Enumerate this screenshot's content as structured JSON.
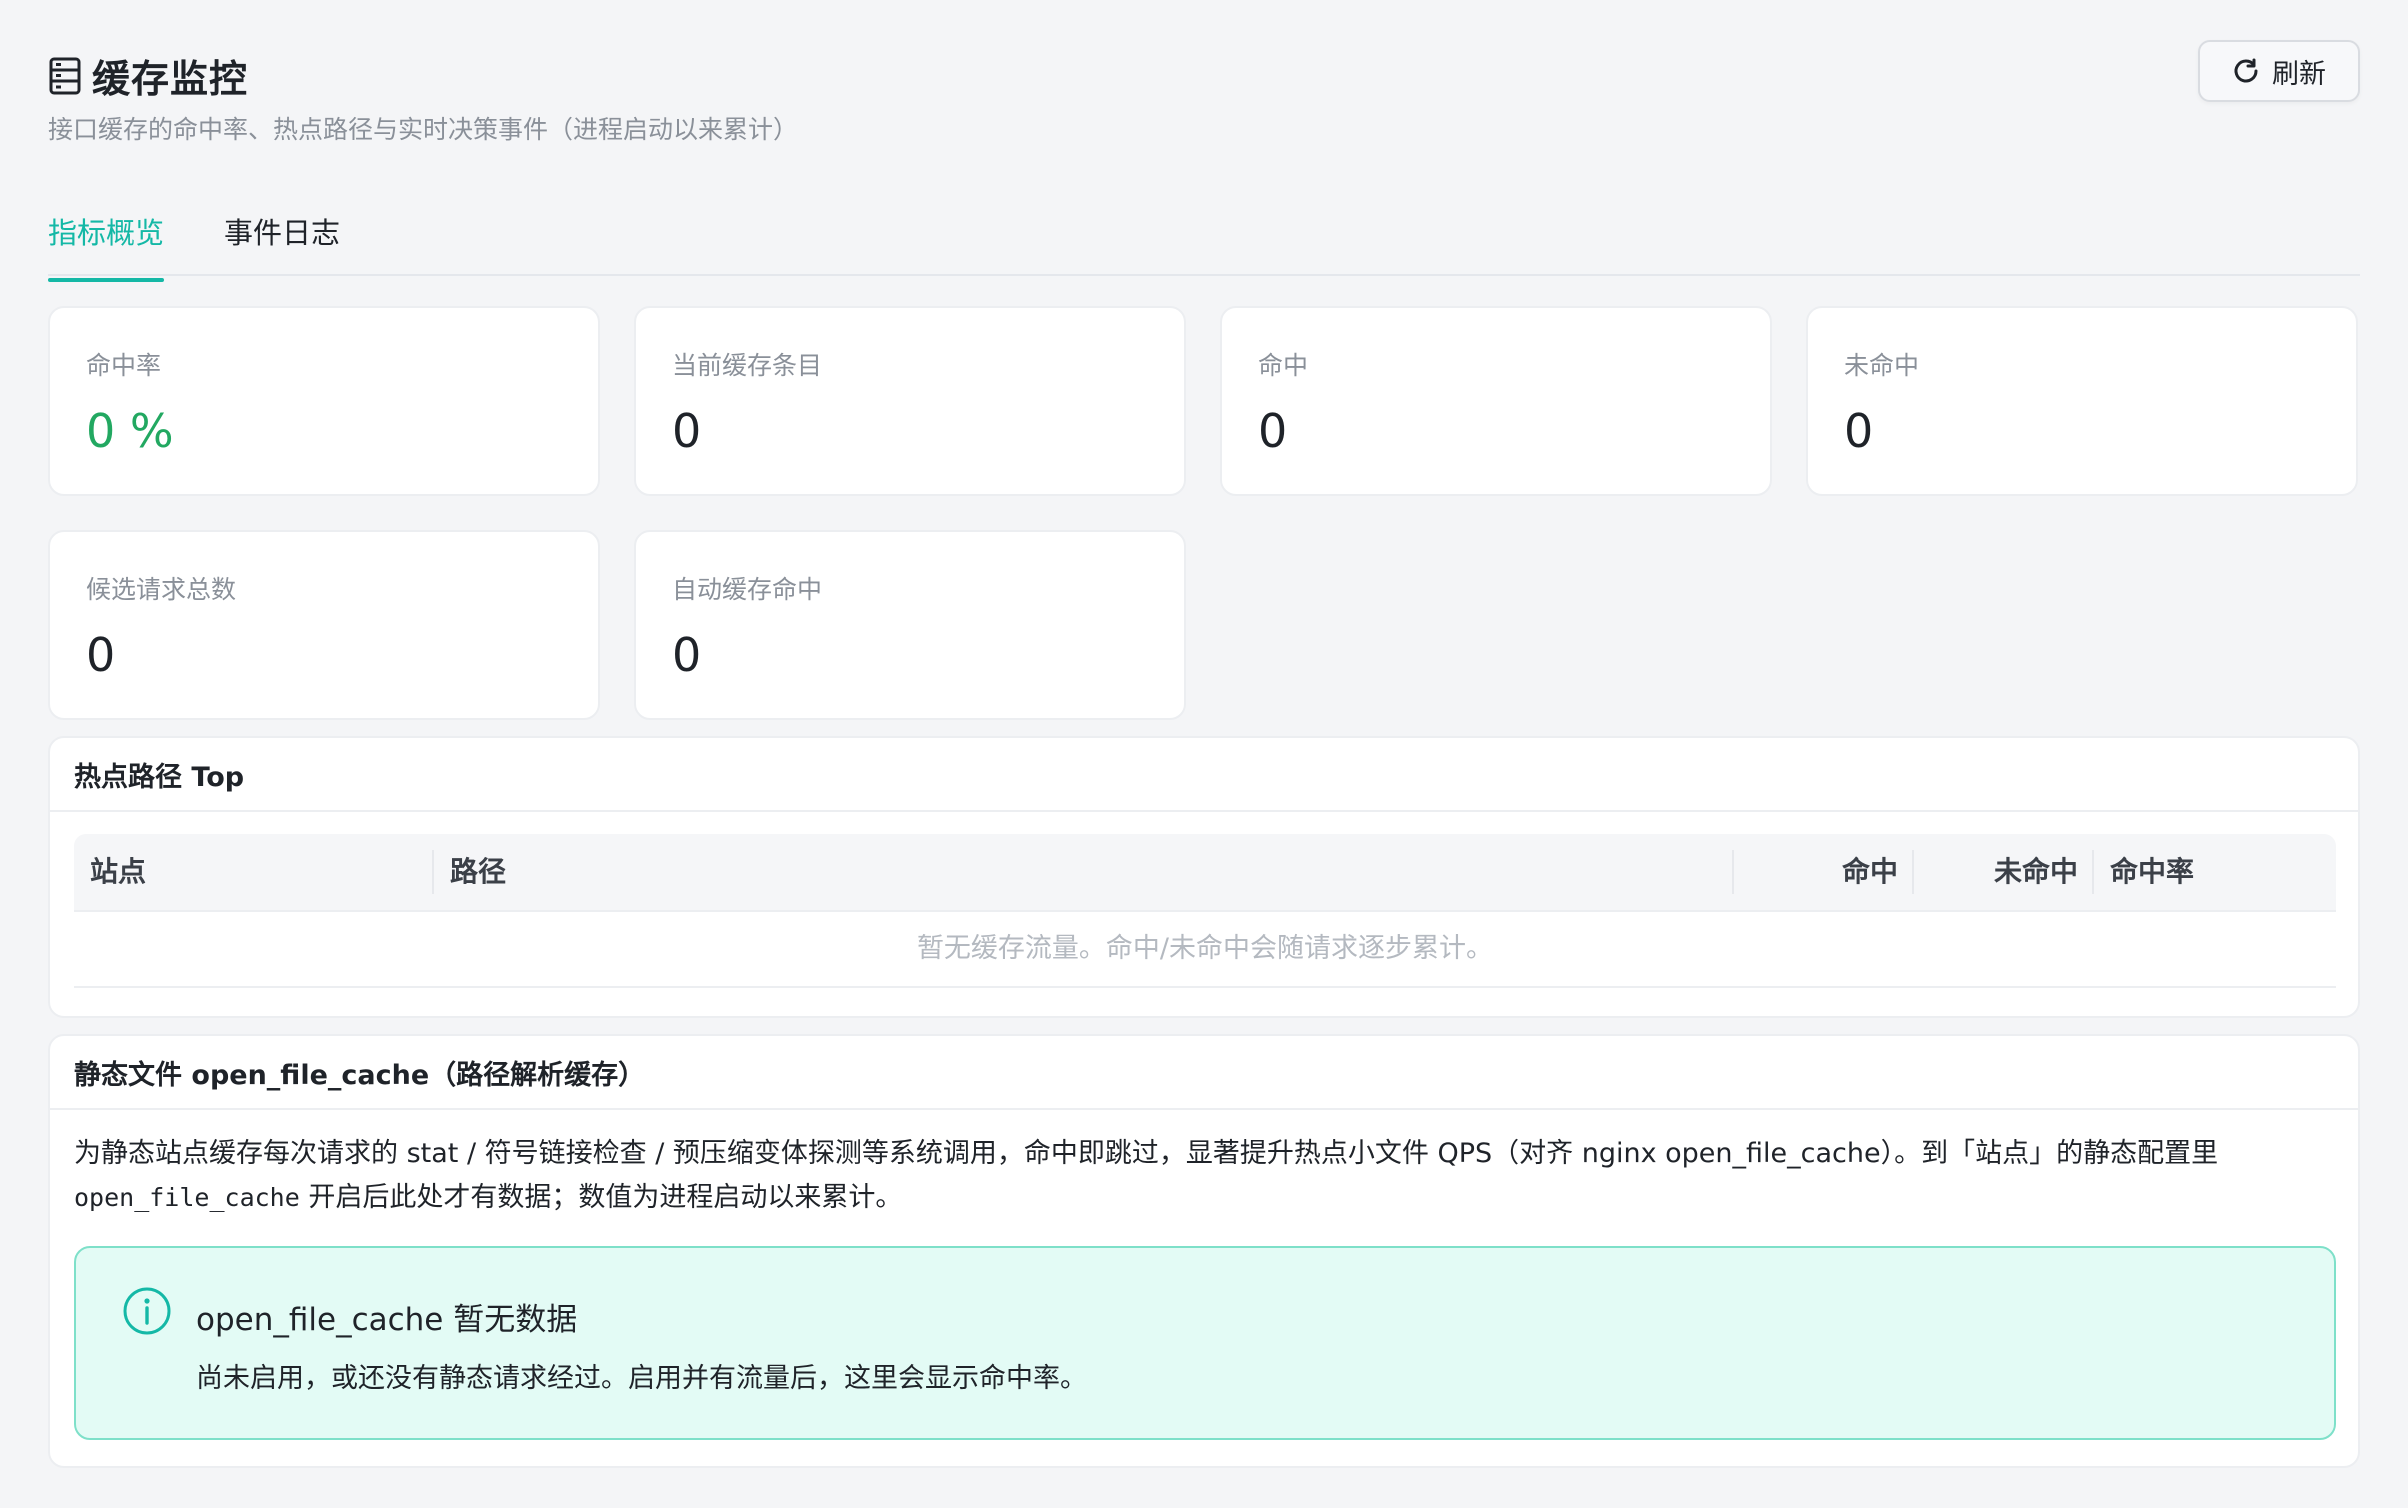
{
  "header": {
    "title": "缓存监控",
    "subtitle": "接口缓存的命中率、热点路径与实时决策事件（进程启动以来累计）",
    "refresh_label": "刷新"
  },
  "tabs": [
    {
      "label": "指标概览",
      "active": true
    },
    {
      "label": "事件日志",
      "active": false
    }
  ],
  "stats": [
    {
      "label": "命中率",
      "value": "0 %"
    },
    {
      "label": "当前缓存条目",
      "value": "0"
    },
    {
      "label": "命中",
      "value": "0"
    },
    {
      "label": "未命中",
      "value": "0"
    },
    {
      "label": "候选请求总数",
      "value": "0"
    },
    {
      "label": "自动缓存命中",
      "value": "0"
    }
  ],
  "hot_paths": {
    "title": "热点路径 Top",
    "columns": [
      "站点",
      "路径",
      "命中",
      "未命中",
      "命中率"
    ],
    "empty_text": "暂无缓存流量。命中/未命中会随请求逐步累计。"
  },
  "open_file_cache": {
    "title": "静态文件 open_file_cache（路径解析缓存）",
    "desc_line1": "为静态站点缓存每次请求的 stat / 符号链接检查 / 预压缩变体探测等系统调用，命中即跳过，显著提升热点小文件 QPS（对齐 nginx open_file_cache）。到「站点」的静态配置里",
    "desc_code": "open_file_cache",
    "desc_line2_rest": " 开启后此处才有数据；数值为进程启动以来累计。",
    "alert_title": "open_file_cache 暂无数据",
    "alert_body": "尚未启用，或还没有静态请求经过。启用并有流量后，这里会显示命中率。"
  },
  "colors": {
    "accent": "#14b8a6",
    "success": "#22a861",
    "alert_bg": "#e3fbf5",
    "alert_border": "#7ee0c9"
  }
}
